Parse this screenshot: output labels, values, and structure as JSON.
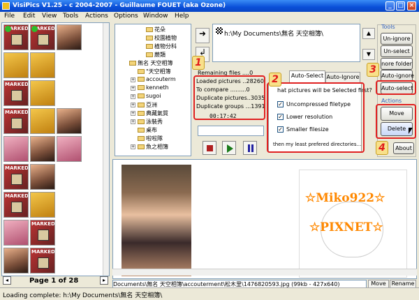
{
  "window": {
    "title": "VisiPics V1.25 - c 2004-2007 - Guillaume FOUET (aka Ozone)",
    "min": "_",
    "max": "□",
    "close": "×"
  },
  "menu": [
    "File",
    "Edit",
    "View",
    "Tools",
    "Actions",
    "Options",
    "Window",
    "Help"
  ],
  "thumbs": {
    "marked_label": "MARKED",
    "page_label": "Page 1 of 28"
  },
  "tree": {
    "items": [
      "花朵",
      "校園植物",
      "植物分科",
      "蕨類",
      "無名 天空相簿",
      "\"天空相簿",
      "accouterm",
      "kenneth",
      "sugoi",
      "亞洲",
      "典藏氣質",
      "泳裝秀",
      "桌布",
      "啦啦隊",
      "魚之相簿"
    ]
  },
  "dirlist": {
    "path": "h:\\My Documents\\無名 天空相簿\\"
  },
  "stats": {
    "remaining": "Remaining files ....0",
    "loaded": "Loaded pictures ..28260",
    "compare": "To compare .........0",
    "dup_pictures": "Duplicate pictures..3035",
    "dup_groups": "Duplicate groups ...1391",
    "timer": "00:17:42"
  },
  "tabs": {
    "auto_select": "Auto-Select",
    "auto_ignore": "Auto-Ignore"
  },
  "autoselect": {
    "question": "hat pictures will be Selected first?",
    "options": [
      "Uncompressed filetype",
      "Lower resolution",
      "Smaller filesize"
    ],
    "least": "then my least prefered directories..."
  },
  "right": {
    "tools_label": "Tools",
    "unignore": "Un-ignore",
    "unselect": "Un-select",
    "more_folder": "nore folder",
    "auto_ignore": "Auto-ignore",
    "auto_select": "Auto-select",
    "actions_label": "Actions",
    "move": "Move",
    "delete": "Delete",
    "about": "About"
  },
  "badges": [
    "1",
    "2",
    "3",
    "4"
  ],
  "watermark": {
    "top": "☆Miko922☆",
    "bottom": "☆PIXNET☆"
  },
  "filebar": {
    "path": "Documents\\無名 天空相簿\\accouterment\\松木里\\1476820593.jpg (99kb - 427x640)",
    "move": "Move",
    "rename": "Rename"
  },
  "status": {
    "text": "Loading complete: h:\\My Documents\\無名 天空相簿\\"
  }
}
